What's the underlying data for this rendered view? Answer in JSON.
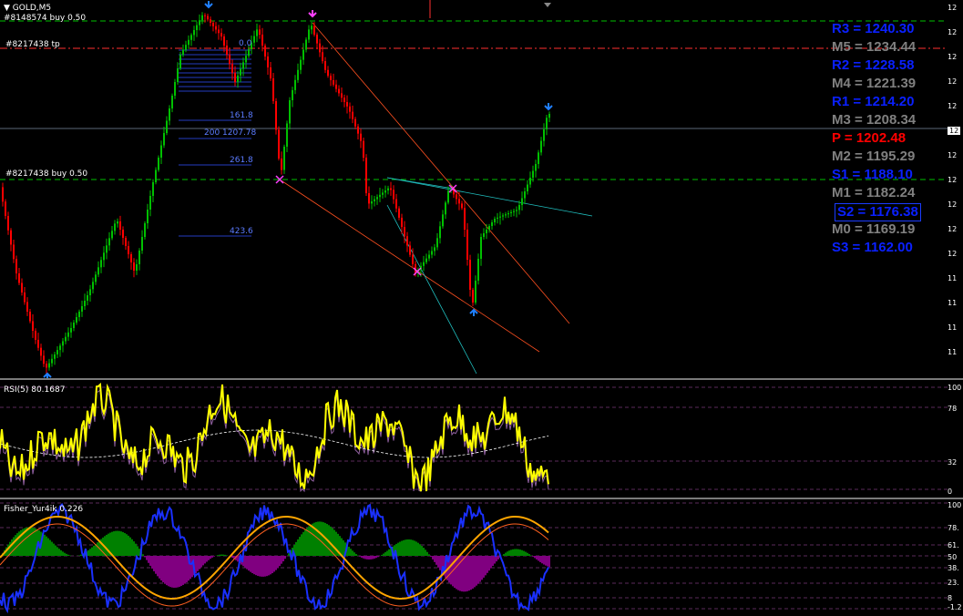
{
  "chart_title": "GOLD,M5",
  "orders": [
    "#8148574 buy 0.50",
    "#8217438 tp",
    "#8217438 buy 0.50"
  ],
  "fib_labels": [
    "0.0",
    "161.8",
    "200 1207.78",
    "261.8",
    "423.6"
  ],
  "pivots": [
    {
      "label": "R3 = 1240.30",
      "color": "#0a20ff"
    },
    {
      "label": "M5 = 1234.44",
      "color": "#808080"
    },
    {
      "label": "R2 = 1228.58",
      "color": "#0a20ff"
    },
    {
      "label": "M4 = 1221.39",
      "color": "#808080"
    },
    {
      "label": "R1 = 1214.20",
      "color": "#0a20ff"
    },
    {
      "label": "M3 = 1208.34",
      "color": "#808080"
    },
    {
      "label": "P  = 1202.48",
      "color": "#ff0000"
    },
    {
      "label": "M2 = 1195.29",
      "color": "#808080"
    },
    {
      "label": "S1 = 1188.10",
      "color": "#0a20ff"
    },
    {
      "label": "M1 = 1182.24",
      "color": "#808080"
    },
    {
      "label": "S2 = 1176.38",
      "color": "#0a20ff"
    },
    {
      "label": "M0 = 1169.19",
      "color": "#808080"
    },
    {
      "label": "S3 = 1162.00",
      "color": "#0a20ff"
    }
  ],
  "price_axis": [
    "12",
    "12",
    "12",
    "12",
    "12",
    "12",
    "12",
    "12",
    "12",
    "12",
    "12",
    "11",
    "11",
    "11",
    "11"
  ],
  "rsi_title": "RSI(5) 80.1687",
  "rsi_axis": [
    "100",
    "78",
    "32",
    "0"
  ],
  "fisher_title": "Fisher_Yur4ik 0.226",
  "fisher_axis": [
    "100",
    "78.",
    "61.",
    "50",
    "38.",
    "23.",
    "8",
    "-1.2"
  ],
  "colors": {
    "bull": "#00c000",
    "bear": "#ff0000",
    "rsi": "#ffff00",
    "fisher": "#ffa500",
    "fisher_bars_up": "#008000",
    "fisher_bars_dn": "#800080"
  }
}
